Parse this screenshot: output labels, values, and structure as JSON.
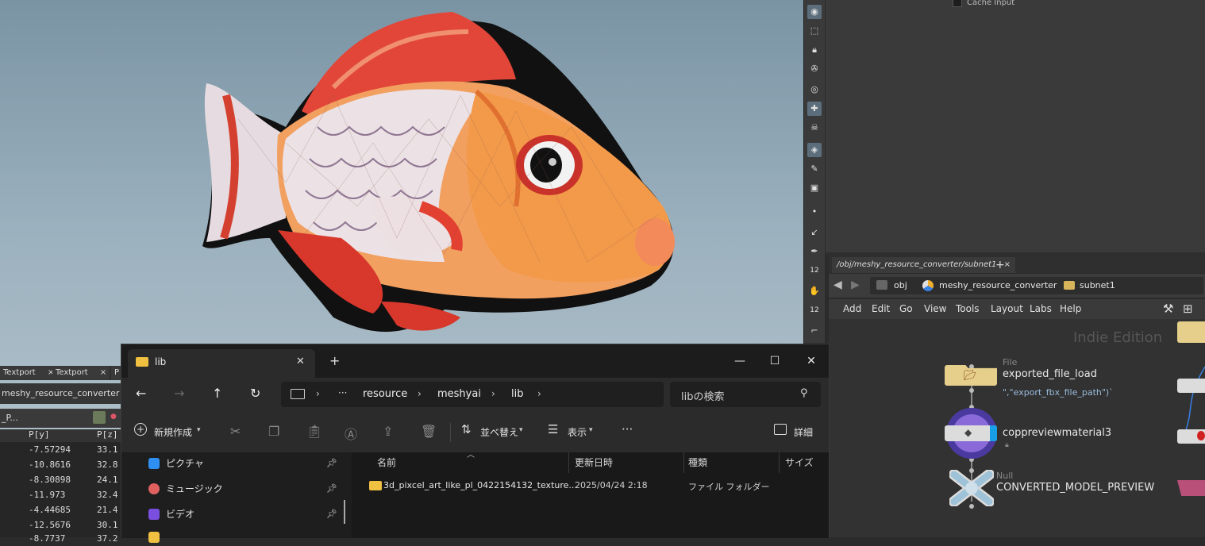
{
  "viewport": {
    "toolbar_icons": [
      "view-icon",
      "select-icon",
      "lock-icon",
      "snap-icon",
      "display-icon",
      "add-icon",
      "skull-icon",
      "camera-icon",
      "paint-icon",
      "render-icon",
      "dot-icon",
      "brush-icon",
      "pen-icon",
      "number-12-icon",
      "hand-icon",
      "number-12-icon",
      "corner-icon"
    ],
    "toolbar_labels": {
      "twelve_a": "12",
      "twelve_b": "12"
    }
  },
  "param_area": {
    "cache_input_label": "Cache Input"
  },
  "network": {
    "tab_label": "/obj/meshy_resource_converter/subnet1",
    "tab_close": "×",
    "tab_add": "+",
    "path": [
      "obj",
      "meshy_resource_converter",
      "subnet1"
    ],
    "menu": [
      "Add",
      "Edit",
      "Go",
      "View",
      "Tools",
      "Layout",
      "Labs",
      "Help"
    ],
    "watermark": "Indie Edition",
    "nodes": [
      {
        "type": "File",
        "name": "exported_file_load",
        "sub": "\",\"export_fbx_file_path\")`"
      },
      {
        "type": "",
        "name": "coppreviewmaterial3",
        "sub": ""
      },
      {
        "type": "Null",
        "name": "CONVERTED_MODEL_PREVIEW",
        "sub": ""
      }
    ]
  },
  "textport": {
    "tabs": [
      "Textport",
      "Textport",
      "P"
    ],
    "tab_close": "×",
    "path": "meshy_resource_converter",
    "header_label": "_P...",
    "columns": [
      "P[y]",
      "P[z]"
    ],
    "rows": [
      {
        "y": "-7.57294",
        "z": "33.1"
      },
      {
        "y": "-10.8616",
        "z": "32.8"
      },
      {
        "y": "-8.30898",
        "z": "24.1"
      },
      {
        "y": "-11.973",
        "z": "32.4"
      },
      {
        "y": "-4.44685",
        "z": "21.4"
      },
      {
        "y": "-12.5676",
        "z": "30.1"
      },
      {
        "y": "-8.7737",
        "z": "37.2"
      }
    ]
  },
  "explorer": {
    "tab_title": "lib",
    "tab_close": "✕",
    "new_tab": "+",
    "window_buttons": {
      "minimize": "—",
      "maximize": "☐",
      "close": "✕"
    },
    "nav": {
      "back": "←",
      "forward": "→",
      "up": "↑",
      "refresh": "↻"
    },
    "address": {
      "more": "···",
      "path": [
        "resource",
        "meshyai",
        "lib"
      ]
    },
    "search_placeholder": "libの検索",
    "commands": {
      "new": "新規作成",
      "sort": "並べ替え",
      "view": "表示",
      "more": "···",
      "details": "詳細"
    },
    "sidebar": [
      {
        "label": "ピクチャ",
        "icon": "pictures-icon",
        "color": "#2f8ff0"
      },
      {
        "label": "ミュージック",
        "icon": "music-icon",
        "color": "#e06060"
      },
      {
        "label": "ビデオ",
        "icon": "videos-icon",
        "color": "#7a4fe0"
      }
    ],
    "columns": [
      "名前",
      "更新日時",
      "種類",
      "サイズ"
    ],
    "files": [
      {
        "name": "3d_pixcel_art_like_pl_0422154132_texture...",
        "date": "2025/04/24 2:18",
        "kind": "ファイル フォルダー",
        "size": ""
      }
    ]
  }
}
